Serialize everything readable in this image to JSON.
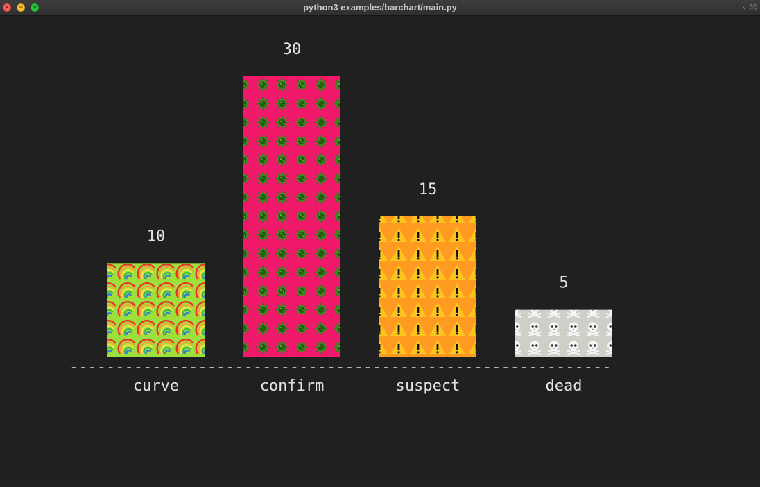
{
  "window": {
    "title": "python3 examples/barchart/main.py",
    "shortcut": "⌥⌘"
  },
  "chart_data": {
    "type": "bar",
    "categories": [
      "curve",
      "confirm",
      "suspect",
      "dead"
    ],
    "values": [
      10,
      30,
      15,
      5
    ],
    "title": "",
    "xlabel": "",
    "ylabel": "",
    "ylim": [
      0,
      30
    ],
    "grid": false,
    "legend": "none",
    "baseline": "-----------------------------------------------------------",
    "bar_colors": [
      "#9ee03b",
      "#f0196a",
      "#fe9b20",
      "#cfcfc8"
    ],
    "bar_icons": [
      "rainbow-icon",
      "virus-icon",
      "warning-icon",
      "skull-icon"
    ]
  }
}
